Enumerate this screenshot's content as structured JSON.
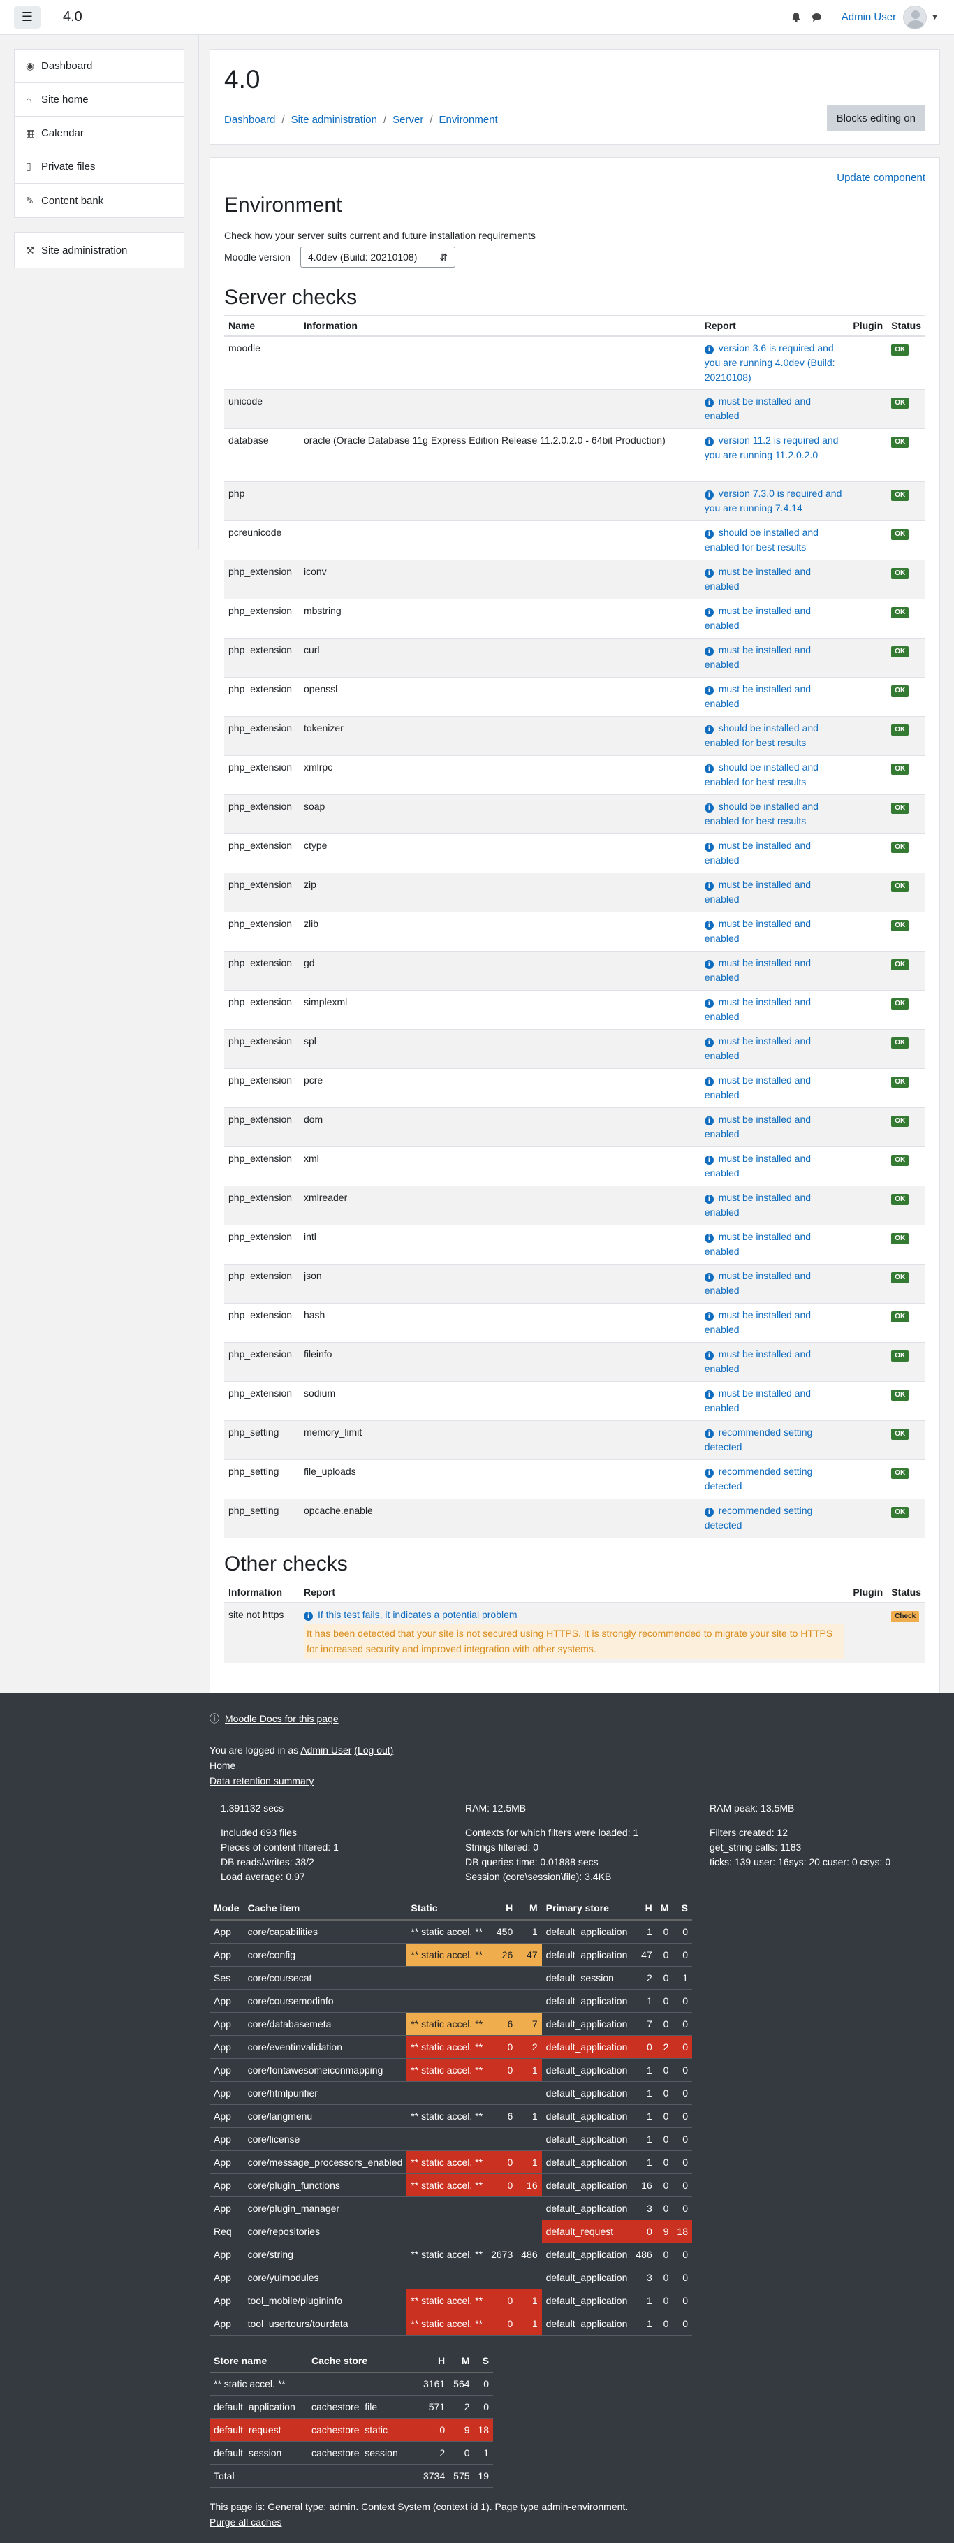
{
  "navbar": {
    "brand": "4.0",
    "user_name": "Admin User"
  },
  "drawer": {
    "items": [
      {
        "label": "Dashboard",
        "icon": "dashboard-icon"
      },
      {
        "label": "Site home",
        "icon": "home-icon"
      },
      {
        "label": "Calendar",
        "icon": "calendar-icon"
      },
      {
        "label": "Private files",
        "icon": "file-icon"
      },
      {
        "label": "Content bank",
        "icon": "brush-icon"
      }
    ],
    "admin_label": "Site administration"
  },
  "header": {
    "title": "4.0",
    "breadcrumb": [
      "Dashboard",
      "Site administration",
      "Server",
      "Environment"
    ],
    "blocks_button": "Blocks editing on"
  },
  "content": {
    "update_component": "Update component",
    "heading": "Environment",
    "description": "Check how your server suits current and future installation requirements",
    "version_label": "Moodle version",
    "version_value": "4.0dev (Build: 20210108)",
    "server_checks_title": "Server checks",
    "server_headers": [
      "Name",
      "Information",
      "Report",
      "Plugin",
      "Status"
    ],
    "server_rows": [
      {
        "name": "moodle",
        "info": "",
        "report": "version 3.6 is required and you are running 4.0dev (Build: 20210108)",
        "status": "OK"
      },
      {
        "name": "unicode",
        "info": "",
        "report": "must be installed and enabled",
        "status": "OK"
      },
      {
        "name": "database",
        "info": "oracle (Oracle Database 11g Express Edition Release 11.2.0.2.0 - 64bit Production)",
        "report": "version 11.2 is required and you are running 11.2.0.2.0",
        "status": "OK"
      },
      {
        "name": "php",
        "info": "",
        "report": "version 7.3.0 is required and you are running 7.4.14",
        "status": "OK"
      },
      {
        "name": "pcreunicode",
        "info": "",
        "report": "should be installed and enabled for best results",
        "status": "OK"
      },
      {
        "name": "php_extension",
        "info": "iconv",
        "report": "must be installed and enabled",
        "status": "OK"
      },
      {
        "name": "php_extension",
        "info": "mbstring",
        "report": "must be installed and enabled",
        "status": "OK"
      },
      {
        "name": "php_extension",
        "info": "curl",
        "report": "must be installed and enabled",
        "status": "OK"
      },
      {
        "name": "php_extension",
        "info": "openssl",
        "report": "must be installed and enabled",
        "status": "OK"
      },
      {
        "name": "php_extension",
        "info": "tokenizer",
        "report": "should be installed and enabled for best results",
        "status": "OK"
      },
      {
        "name": "php_extension",
        "info": "xmlrpc",
        "report": "should be installed and enabled for best results",
        "status": "OK"
      },
      {
        "name": "php_extension",
        "info": "soap",
        "report": "should be installed and enabled for best results",
        "status": "OK"
      },
      {
        "name": "php_extension",
        "info": "ctype",
        "report": "must be installed and enabled",
        "status": "OK"
      },
      {
        "name": "php_extension",
        "info": "zip",
        "report": "must be installed and enabled",
        "status": "OK"
      },
      {
        "name": "php_extension",
        "info": "zlib",
        "report": "must be installed and enabled",
        "status": "OK"
      },
      {
        "name": "php_extension",
        "info": "gd",
        "report": "must be installed and enabled",
        "status": "OK"
      },
      {
        "name": "php_extension",
        "info": "simplexml",
        "report": "must be installed and enabled",
        "status": "OK"
      },
      {
        "name": "php_extension",
        "info": "spl",
        "report": "must be installed and enabled",
        "status": "OK"
      },
      {
        "name": "php_extension",
        "info": "pcre",
        "report": "must be installed and enabled",
        "status": "OK"
      },
      {
        "name": "php_extension",
        "info": "dom",
        "report": "must be installed and enabled",
        "status": "OK"
      },
      {
        "name": "php_extension",
        "info": "xml",
        "report": "must be installed and enabled",
        "status": "OK"
      },
      {
        "name": "php_extension",
        "info": "xmlreader",
        "report": "must be installed and enabled",
        "status": "OK"
      },
      {
        "name": "php_extension",
        "info": "intl",
        "report": "must be installed and enabled",
        "status": "OK"
      },
      {
        "name": "php_extension",
        "info": "json",
        "report": "must be installed and enabled",
        "status": "OK"
      },
      {
        "name": "php_extension",
        "info": "hash",
        "report": "must be installed and enabled",
        "status": "OK"
      },
      {
        "name": "php_extension",
        "info": "fileinfo",
        "report": "must be installed and enabled",
        "status": "OK"
      },
      {
        "name": "php_extension",
        "info": "sodium",
        "report": "must be installed and enabled",
        "status": "OK"
      },
      {
        "name": "php_setting",
        "info": "memory_limit",
        "report": "recommended setting detected",
        "status": "OK"
      },
      {
        "name": "php_setting",
        "info": "file_uploads",
        "report": "recommended setting detected",
        "status": "OK"
      },
      {
        "name": "php_setting",
        "info": "opcache.enable",
        "report": "recommended setting detected",
        "status": "OK"
      }
    ],
    "other_checks_title": "Other checks",
    "other_headers": [
      "Information",
      "Report",
      "Plugin",
      "Status"
    ],
    "other_row": {
      "info": "site not https",
      "report": "If this test fails, it indicates a potential problem",
      "warning": "It has been detected that your site is not secured using HTTPS. It is strongly recommended to migrate your site to HTTPS for increased security and improved integration with other systems.",
      "status": "Check"
    }
  },
  "footer": {
    "docs_link": "Moodle Docs for this page",
    "logged_prefix": "You are logged in as",
    "logged_user": "Admin User",
    "logout": "(Log out)",
    "home": "Home",
    "data_retention": "Data retention summary",
    "perf": {
      "col1": [
        "1.391132 secs",
        "",
        "Included 693 files",
        "Pieces of content filtered: 1",
        "DB reads/writes: 38/2",
        "Load average: 0.97"
      ],
      "col2": [
        "RAM: 12.5MB",
        "",
        "Contexts for which filters were loaded: 1",
        "Strings filtered: 0",
        "DB queries time: 0.01888 secs",
        "Session (core\\session\\file): 3.4KB"
      ],
      "col3": [
        "RAM peak: 13.5MB",
        "",
        "Filters created: 12",
        "get_string calls: 1183",
        "ticks: 139 user: 16sys: 20 cuser: 0 csys: 0",
        ""
      ]
    },
    "cache_headers": [
      "Mode",
      "Cache item",
      "Static",
      "H",
      "M",
      "Primary store",
      "H",
      "M",
      "S"
    ],
    "cache_rows": [
      {
        "mode": "App",
        "item": "core/capabilities",
        "static": "** static accel. **",
        "h": "450",
        "m": "1",
        "store": "default_application",
        "sh": "1",
        "sm": "0",
        "ss": "0",
        "sc": "",
        "pc": ""
      },
      {
        "mode": "App",
        "item": "core/config",
        "static": "** static accel. **",
        "h": "26",
        "m": "47",
        "store": "default_application",
        "sh": "47",
        "sm": "0",
        "ss": "0",
        "sc": "warn",
        "pc": ""
      },
      {
        "mode": "Ses",
        "item": "core/coursecat",
        "static": "",
        "h": "",
        "m": "",
        "store": "default_session",
        "sh": "2",
        "sm": "0",
        "ss": "1",
        "sc": "",
        "pc": ""
      },
      {
        "mode": "App",
        "item": "core/coursemodinfo",
        "static": "",
        "h": "",
        "m": "",
        "store": "default_application",
        "sh": "1",
        "sm": "0",
        "ss": "0",
        "sc": "",
        "pc": ""
      },
      {
        "mode": "App",
        "item": "core/databasemeta",
        "static": "** static accel. **",
        "h": "6",
        "m": "7",
        "store": "default_application",
        "sh": "7",
        "sm": "0",
        "ss": "0",
        "sc": "warn",
        "pc": ""
      },
      {
        "mode": "App",
        "item": "core/eventinvalidation",
        "static": "** static accel. **",
        "h": "0",
        "m": "2",
        "store": "default_application",
        "sh": "0",
        "sm": "2",
        "ss": "0",
        "sc": "bad",
        "pc": "bad"
      },
      {
        "mode": "App",
        "item": "core/fontawesomeiconmapping",
        "static": "** static accel. **",
        "h": "0",
        "m": "1",
        "store": "default_application",
        "sh": "1",
        "sm": "0",
        "ss": "0",
        "sc": "bad",
        "pc": ""
      },
      {
        "mode": "App",
        "item": "core/htmlpurifier",
        "static": "",
        "h": "",
        "m": "",
        "store": "default_application",
        "sh": "1",
        "sm": "0",
        "ss": "0",
        "sc": "",
        "pc": ""
      },
      {
        "mode": "App",
        "item": "core/langmenu",
        "static": "** static accel. **",
        "h": "6",
        "m": "1",
        "store": "default_application",
        "sh": "1",
        "sm": "0",
        "ss": "0",
        "sc": "",
        "pc": ""
      },
      {
        "mode": "App",
        "item": "core/license",
        "static": "",
        "h": "",
        "m": "",
        "store": "default_application",
        "sh": "1",
        "sm": "0",
        "ss": "0",
        "sc": "",
        "pc": ""
      },
      {
        "mode": "App",
        "item": "core/message_processors_enabled",
        "static": "** static accel. **",
        "h": "0",
        "m": "1",
        "store": "default_application",
        "sh": "1",
        "sm": "0",
        "ss": "0",
        "sc": "bad",
        "pc": ""
      },
      {
        "mode": "App",
        "item": "core/plugin_functions",
        "static": "** static accel. **",
        "h": "0",
        "m": "16",
        "store": "default_application",
        "sh": "16",
        "sm": "0",
        "ss": "0",
        "sc": "bad",
        "pc": ""
      },
      {
        "mode": "App",
        "item": "core/plugin_manager",
        "static": "",
        "h": "",
        "m": "",
        "store": "default_application",
        "sh": "3",
        "sm": "0",
        "ss": "0",
        "sc": "",
        "pc": ""
      },
      {
        "mode": "Req",
        "item": "core/repositories",
        "static": "",
        "h": "",
        "m": "",
        "store": "default_request",
        "sh": "0",
        "sm": "9",
        "ss": "18",
        "sc": "",
        "pc": "bad"
      },
      {
        "mode": "App",
        "item": "core/string",
        "static": "** static accel. **",
        "h": "2673",
        "m": "486",
        "store": "default_application",
        "sh": "486",
        "sm": "0",
        "ss": "0",
        "sc": "",
        "pc": ""
      },
      {
        "mode": "App",
        "item": "core/yuimodules",
        "static": "",
        "h": "",
        "m": "",
        "store": "default_application",
        "sh": "3",
        "sm": "0",
        "ss": "0",
        "sc": "",
        "pc": ""
      },
      {
        "mode": "App",
        "item": "tool_mobile/plugininfo",
        "static": "** static accel. **",
        "h": "0",
        "m": "1",
        "store": "default_application",
        "sh": "1",
        "sm": "0",
        "ss": "0",
        "sc": "bad",
        "pc": ""
      },
      {
        "mode": "App",
        "item": "tool_usertours/tourdata",
        "static": "** static accel. **",
        "h": "0",
        "m": "1",
        "store": "default_application",
        "sh": "1",
        "sm": "0",
        "ss": "0",
        "sc": "bad",
        "pc": ""
      }
    ],
    "store_headers": [
      "Store name",
      "Cache store",
      "H",
      "M",
      "S"
    ],
    "store_rows": [
      {
        "name": "** static accel. **",
        "store": "",
        "h": "3161",
        "m": "564",
        "s": "0",
        "c": ""
      },
      {
        "name": "default_application",
        "store": "cachestore_file",
        "h": "571",
        "m": "2",
        "s": "0",
        "c": ""
      },
      {
        "name": "default_request",
        "store": "cachestore_static",
        "h": "0",
        "m": "9",
        "s": "18",
        "c": "bad"
      },
      {
        "name": "default_session",
        "store": "cachestore_session",
        "h": "2",
        "m": "0",
        "s": "1",
        "c": ""
      },
      {
        "name": "Total",
        "store": "",
        "h": "3734",
        "m": "575",
        "s": "19",
        "c": ""
      }
    ],
    "page_info": "This page is: General type: admin. Context System (context id 1). Page type admin-environment.",
    "purge": "Purge all caches"
  }
}
